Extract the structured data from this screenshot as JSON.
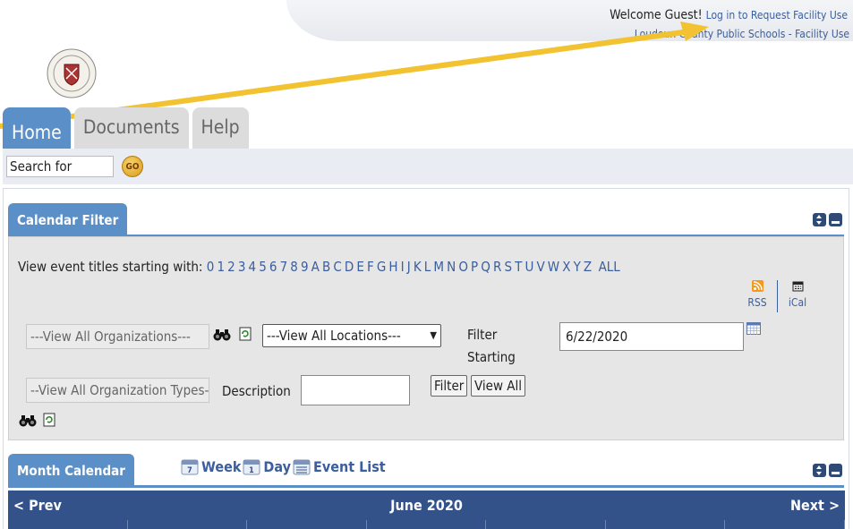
{
  "header": {
    "welcome_text": "Welcome Guest!",
    "login_link": "Log in to Request Facility Use",
    "org_link": "Loudoun County Public Schools - Facility Use"
  },
  "tabs": [
    {
      "label": "Home",
      "active": true
    },
    {
      "label": "Documents",
      "active": false
    },
    {
      "label": "Help",
      "active": false
    }
  ],
  "search": {
    "value": "Search for",
    "go_label": "GO"
  },
  "calendar_filter": {
    "title": "Calendar Filter",
    "letters_label": "View event titles starting with:",
    "letters": [
      "0",
      "1",
      "2",
      "3",
      "4",
      "5",
      "6",
      "7",
      "8",
      "9",
      "A",
      "B",
      "C",
      "D",
      "E",
      "F",
      "G",
      "H",
      "I",
      "J",
      "K",
      "L",
      "M",
      "N",
      "O",
      "P",
      "Q",
      "R",
      "S",
      "T",
      "U",
      "V",
      "W",
      "X",
      "Y",
      "Z"
    ],
    "all_label": "ALL",
    "rss_label": "RSS",
    "ical_label": "iCal",
    "org_select": "---View All Organizations---",
    "loc_select": "---View All Locations---",
    "orgtype_select": "--View All Organization Types--",
    "filter_starting_label": "Filter Starting",
    "date_value": "6/22/2020",
    "description_label": "Description",
    "filter_button": "Filter",
    "view_all_button": "View All"
  },
  "month_calendar": {
    "title": "Month Calendar",
    "views": [
      {
        "label": "Week",
        "icon": "week-calendar-icon"
      },
      {
        "label": "Day",
        "icon": "day-calendar-icon"
      },
      {
        "label": "Event List",
        "icon": "list-calendar-icon"
      }
    ],
    "prev_label": "< Prev",
    "month_label": "June 2020",
    "next_label": "Next >"
  },
  "colors": {
    "accent": "#5b8fc7",
    "calendar_bar": "#33528a",
    "link": "#3b5e9e",
    "highlight_arrow": "#f2c230"
  }
}
